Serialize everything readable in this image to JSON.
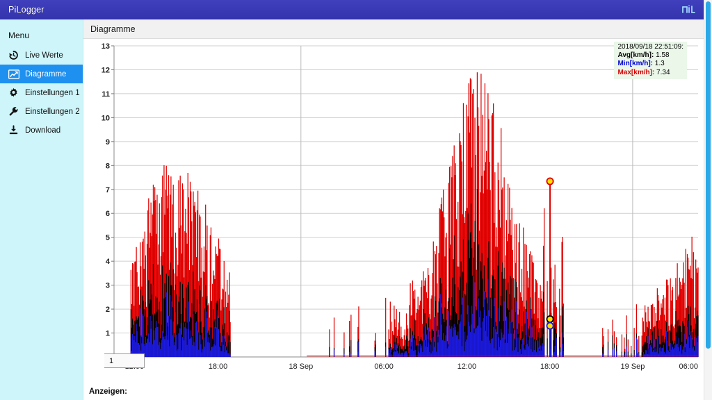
{
  "window": {
    "title": "PiLogger",
    "logo_name": "pil-logo"
  },
  "sidebar": {
    "heading": "Menu",
    "items": [
      {
        "label": "Live Werte",
        "icon": "clock-history-icon",
        "name": "sidebar-item-live-werte",
        "active": false
      },
      {
        "label": "Diagramme",
        "icon": "chart-line-icon",
        "name": "sidebar-item-diagramme",
        "active": true
      },
      {
        "label": "Einstellungen 1",
        "icon": "gear-icon",
        "name": "sidebar-item-einstellungen-1",
        "active": false
      },
      {
        "label": "Einstellungen 2",
        "icon": "wrench-icon",
        "name": "sidebar-item-einstellungen-2",
        "active": false
      },
      {
        "label": "Download",
        "icon": "download-icon",
        "name": "sidebar-item-download",
        "active": false
      }
    ]
  },
  "page": {
    "title": "Diagramme",
    "footer_label": "Anzeigen:"
  },
  "tooltip": {
    "timestamp": "2018/09/18 22:51:09:",
    "avg_key": "Avg[km/h]:",
    "avg_value": "1.58",
    "min_key": "Min[km/h]:",
    "min_value": "1.3",
    "max_key": "Max[km/h]:",
    "max_value": "7.34"
  },
  "series_legend": {
    "label": "1"
  },
  "colors": {
    "header": "#3b3bb5",
    "sidebar": "#cdf5fa",
    "accent": "#1e90ef",
    "max_series": "#e00000",
    "avg_series": "#000000",
    "min_series": "#1a1ae0",
    "marker_fill": "#ffe000",
    "grid": "#cfcfcf",
    "scrollbar": "#2aa9e8"
  },
  "chart_data": {
    "type": "line",
    "title": "",
    "xlabel": "",
    "ylabel": "",
    "ylim": [
      0,
      13
    ],
    "yticks": [
      0,
      1,
      2,
      3,
      4,
      5,
      6,
      7,
      8,
      9,
      10,
      11,
      12,
      13
    ],
    "grid": true,
    "legend": "bottom-left",
    "xtick_labels": [
      "12:00",
      "18:00",
      "18 Sep",
      "06:00",
      "12:00",
      "18:00",
      "19 Sep",
      "06:00"
    ],
    "xtick_positions": [
      0.035,
      0.178,
      0.32,
      0.462,
      0.604,
      0.746,
      0.888,
      1.0
    ],
    "unit": "km/h",
    "series": [
      {
        "name": "Max[km/h]",
        "color": "#e00000"
      },
      {
        "name": "Avg[km/h]",
        "color": "#000000"
      },
      {
        "name": "Min[km/h]",
        "color": "#1a1ae0"
      }
    ],
    "markers": [
      {
        "series": "Max[km/h]",
        "x_fraction": 0.7465,
        "value": 7.34
      },
      {
        "series": "Avg[km/h]",
        "x_fraction": 0.7465,
        "value": 1.58
      },
      {
        "series": "Min[km/h]",
        "x_fraction": 0.7465,
        "value": 1.3
      }
    ],
    "summary": {
      "avg": 1.58,
      "min": 1.3,
      "max": 7.34,
      "global_peak": 12.1
    },
    "envelope_note": "Dense per-minute wind-speed spikes; activity bursts around 12:00-18:00 day 1, quiet overnight, strong peak block 10:00-18:00 day 2 reaching ~12, renewed activity after 06:00 day 3."
  }
}
